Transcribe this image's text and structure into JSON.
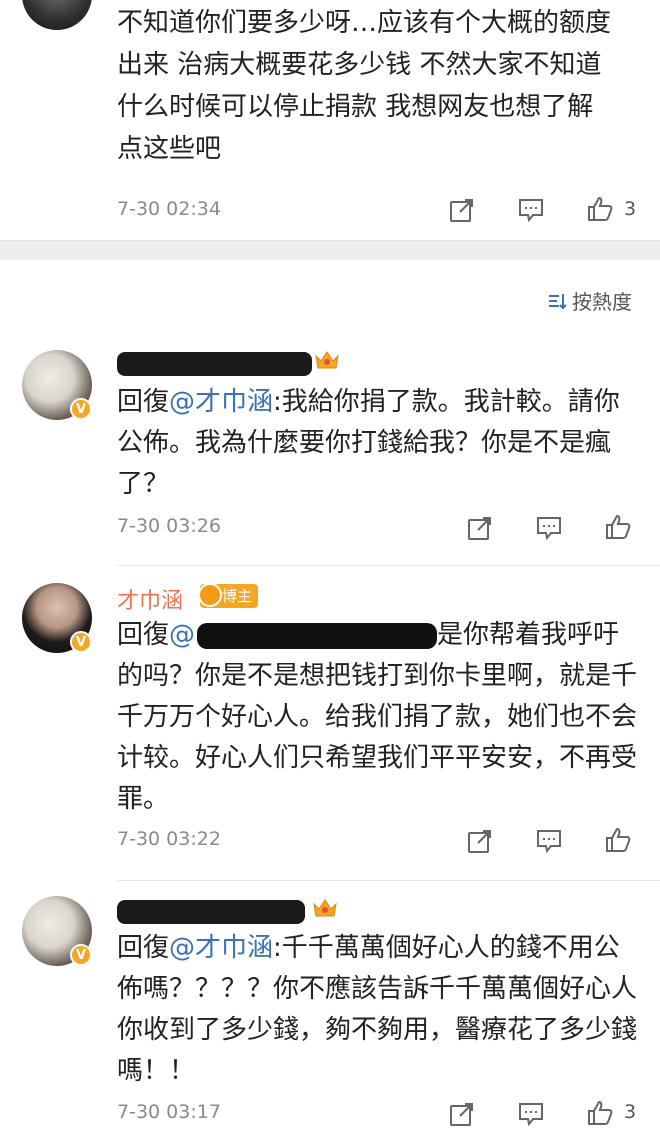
{
  "top_comment": {
    "text": "不知道你们要多少呀…应该有个大概的额度\n出来 治病大概要花多少钱 不然大家不知道\n什么时候可以停止捐款 我想网友也想了解\n点这些吧",
    "time": "7-30 02:34",
    "like_count": "3"
  },
  "sort": {
    "label": "按熱度"
  },
  "comments": [
    {
      "reply_prefix": "回復",
      "mention": "@才巾涵",
      "text": ":我給你捐了款。我計較。請你公佈。我為什麼要你打錢給我？你是不是瘋了？",
      "time": "7-30 03:26",
      "like_count": ""
    },
    {
      "username": "才巾涵",
      "badge": "博主",
      "reply_prefix": "回復",
      "mention": "@",
      "text": "是你帮着我呼吁的吗？你是不是想把钱打到你卡里啊，就是千千万万个好心人。给我们捐了款，她们也不会计较。好心人们只希望我们平平安安，不再受罪。",
      "time": "7-30 03:22",
      "like_count": ""
    },
    {
      "reply_prefix": "回復",
      "mention": "@才巾涵",
      "text": ":千千萬萬個好心人的錢不用公佈嗎？？？？你不應該告訴千千萬萬個好心人你收到了多少錢，夠不夠用，醫療花了多少錢嗎！！",
      "time": "7-30 03:17",
      "like_count": "3"
    }
  ],
  "colors": {
    "mention": "#3a72b8",
    "username": "#eb7350",
    "badge": "#f5a623",
    "meta": "#8a8a8a"
  },
  "icons": [
    "share-icon",
    "comment-icon",
    "like-icon",
    "sort-icon",
    "crown-icon",
    "verified-icon"
  ]
}
